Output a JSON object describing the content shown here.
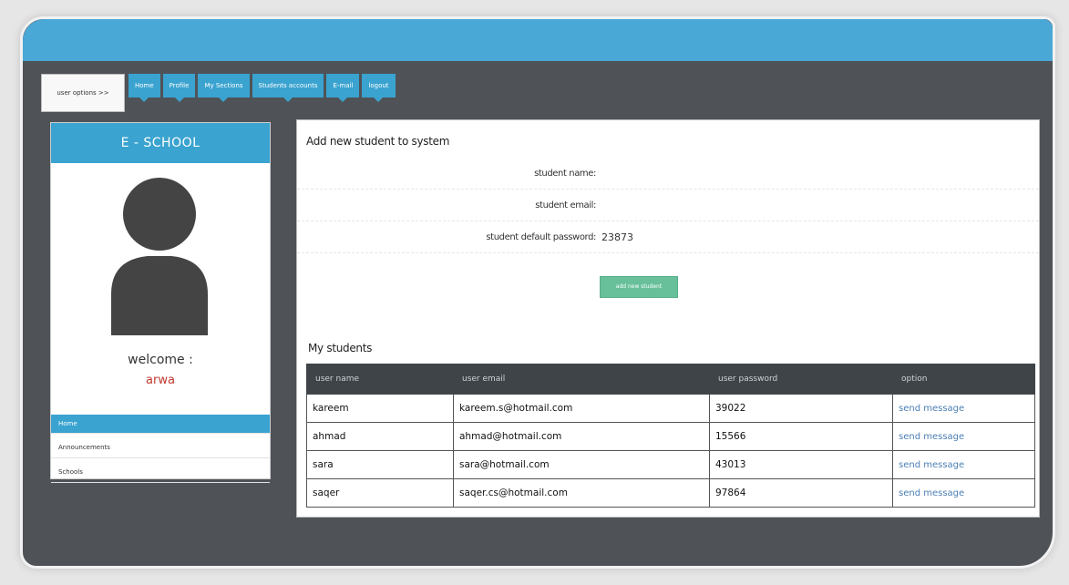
{
  "nav": {
    "user_options": "user options >>",
    "tabs": [
      "Home",
      "Profile",
      "My Sections",
      "Students accounts",
      "E-mail",
      "logout"
    ]
  },
  "sidebar": {
    "brand": "E - SCHOOL",
    "welcome": "welcome :",
    "username": "arwa",
    "items": [
      "Home",
      "Announcements",
      "Schools"
    ]
  },
  "form": {
    "title": "Add new student to system",
    "name_label": "student name:",
    "email_label": "student email:",
    "password_label": "student default password:",
    "password_value": "23873",
    "add_button": "add new student"
  },
  "students": {
    "title": "My students",
    "headers": [
      "user name",
      "user email",
      "user password",
      "option"
    ],
    "rows": [
      [
        "kareem",
        "kareem.s@hotmail.com",
        "39022",
        "send message"
      ],
      [
        "ahmad",
        "ahmad@hotmail.com",
        "15566",
        "send message"
      ],
      [
        "sara",
        "sara@hotmail.com",
        "43013",
        "send message"
      ],
      [
        "saqer",
        "saqer.cs@hotmail.com",
        "97864",
        "send message"
      ]
    ]
  },
  "colors": {
    "accent": "#3aa3d0",
    "frame": "#4f5257",
    "button": "#67c09a",
    "username": "#c0392b",
    "link": "#4a7fb5"
  }
}
